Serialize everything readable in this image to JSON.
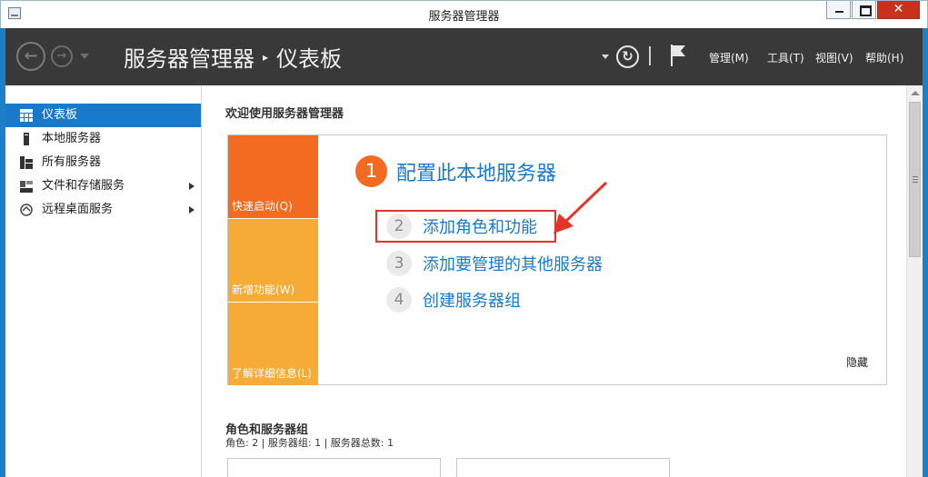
{
  "window": {
    "title": "服务器管理器",
    "min_label": "",
    "max_label": "",
    "close_label": "✕"
  },
  "header": {
    "breadcrumb": [
      "服务器管理器",
      "仪表板"
    ],
    "breadcrumb_sep": "▸",
    "menus": [
      "管理(M)",
      "工具(T)",
      "视图(V)",
      "帮助(H)"
    ],
    "back_glyph": "←",
    "forward_glyph": "→",
    "refresh_glyph": "↻"
  },
  "sidebar": {
    "items": [
      {
        "label": "仪表板",
        "icon": "dashboard-icon",
        "active": true,
        "arrow": false
      },
      {
        "label": "本地服务器",
        "icon": "local-server-icon",
        "active": false,
        "arrow": false
      },
      {
        "label": "所有服务器",
        "icon": "all-servers-icon",
        "active": false,
        "arrow": false
      },
      {
        "label": "文件和存储服务",
        "icon": "file-storage-icon",
        "active": false,
        "arrow": true
      },
      {
        "label": "远程桌面服务",
        "icon": "remote-desktop-icon",
        "active": false,
        "arrow": true
      }
    ]
  },
  "main": {
    "welcome_title": "欢迎使用服务器管理器",
    "tiles": [
      "快速启动(Q)",
      "新增功能(W)",
      "了解详细信息(L)"
    ],
    "step1": {
      "num": "1",
      "label": "配置此本地服务器"
    },
    "steps": [
      {
        "num": "2",
        "label": "添加角色和功能"
      },
      {
        "num": "3",
        "label": "添加要管理的其他服务器"
      },
      {
        "num": "4",
        "label": "创建服务器组"
      }
    ],
    "hide_label": "隐藏",
    "roles_title": "角色和服务器组",
    "roles_summary": "角色: 2 | 服务器组: 1 | 服务器总数: 1"
  },
  "colors": {
    "accent_blue": "#1979ca",
    "orange": "#f36a21",
    "amber": "#f7ab37",
    "header_bg": "#393939",
    "highlight_red": "#e2342b"
  }
}
